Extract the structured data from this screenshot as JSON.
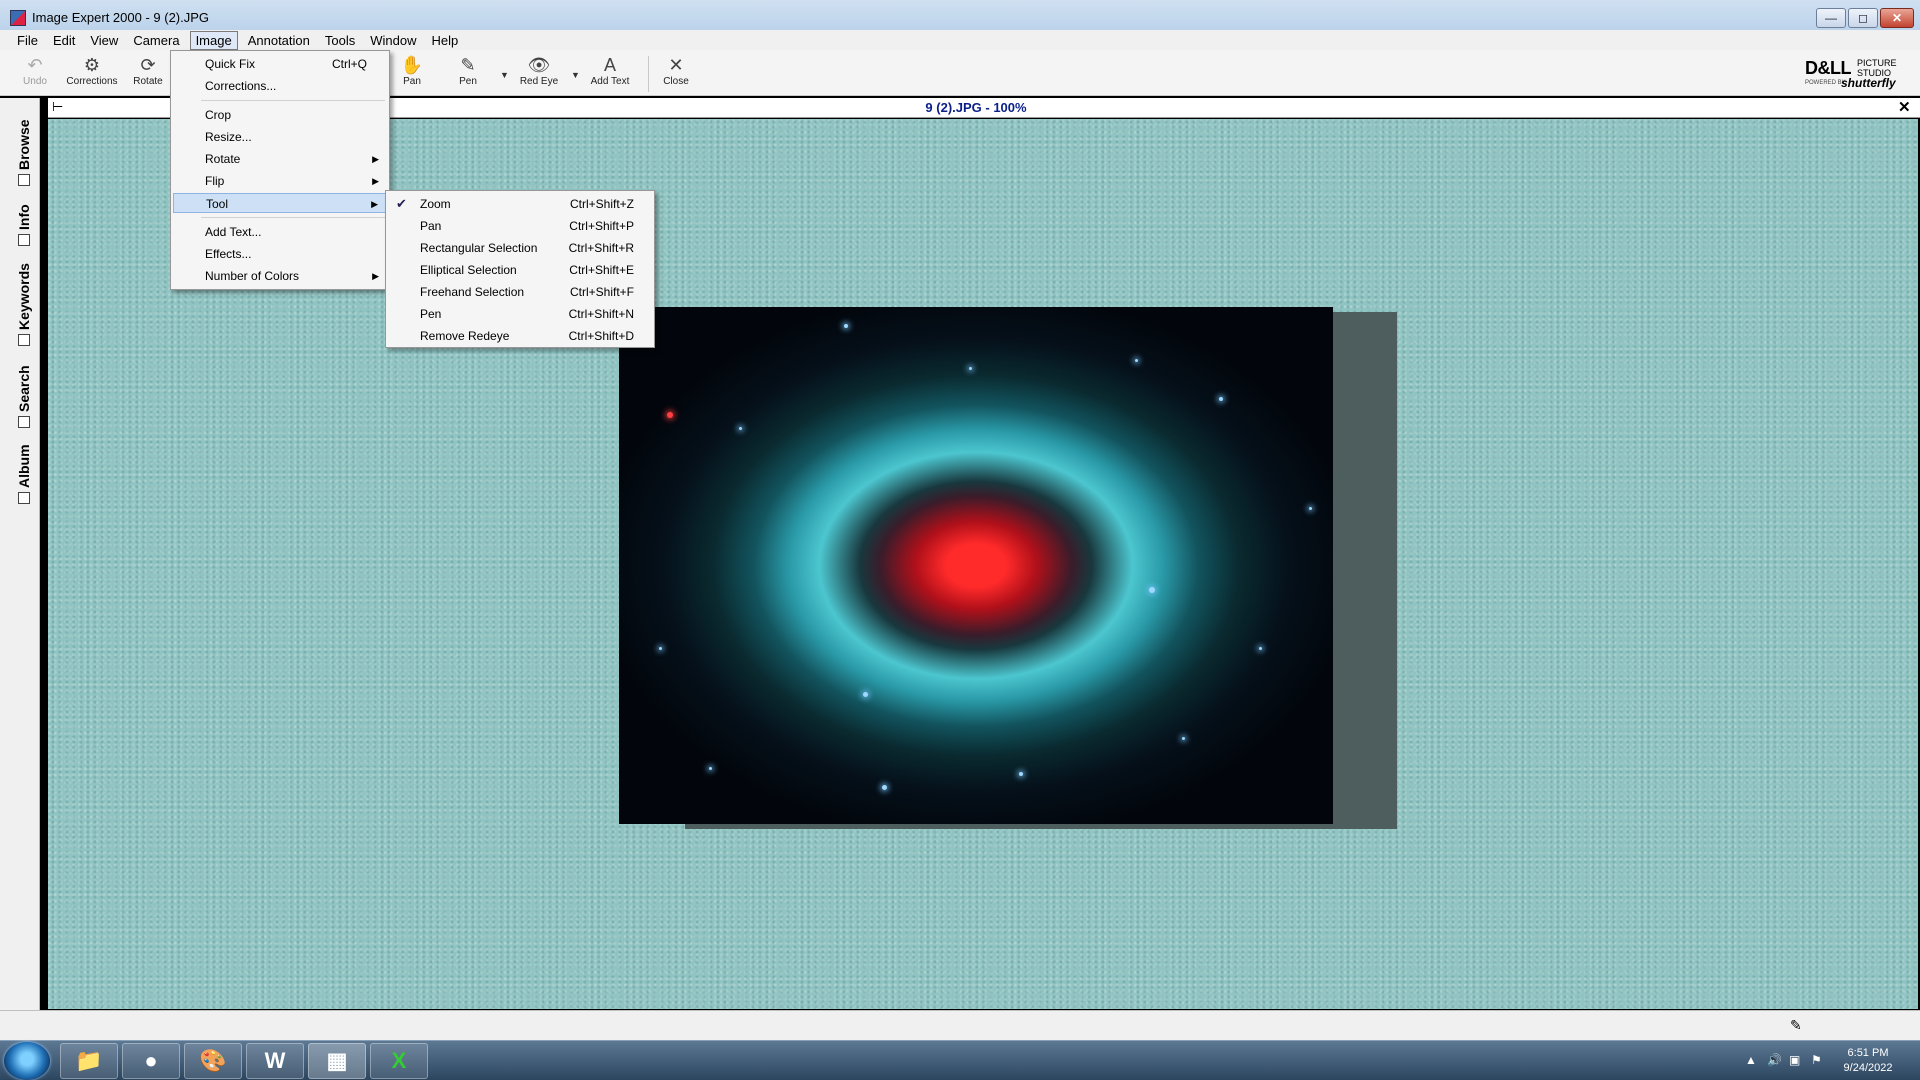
{
  "window": {
    "title": "Image Expert 2000 - 9 (2).JPG"
  },
  "menubar": [
    {
      "label": "File"
    },
    {
      "label": "Edit"
    },
    {
      "label": "View"
    },
    {
      "label": "Camera"
    },
    {
      "label": "Image"
    },
    {
      "label": "Annotation"
    },
    {
      "label": "Tools"
    },
    {
      "label": "Window"
    },
    {
      "label": "Help"
    }
  ],
  "toolbar": {
    "undo": "Undo",
    "corrections": "Corrections",
    "rotate": "Rotate",
    "pan": "Pan",
    "pen": "Pen",
    "red_eye": "Red Eye",
    "add_text": "Add Text",
    "close": "Close"
  },
  "brand": {
    "dell": "D&LL",
    "picture_studio": "PICTURE STUDIO",
    "powered_by": "POWERED BY",
    "shutterfly": "shutterfly"
  },
  "side_tabs": [
    {
      "label": "Browse"
    },
    {
      "label": "Info"
    },
    {
      "label": "Keywords"
    },
    {
      "label": "Search"
    },
    {
      "label": "Album"
    }
  ],
  "document": {
    "title": "9 (2).JPG - 100%"
  },
  "image_menu": {
    "items": [
      {
        "label": "Quick Fix",
        "shortcut": "Ctrl+Q"
      },
      {
        "label": "Corrections..."
      },
      {
        "label": "Crop"
      },
      {
        "label": "Resize..."
      },
      {
        "label": "Rotate"
      },
      {
        "label": "Flip"
      },
      {
        "label": "Tool"
      },
      {
        "label": "Add Text..."
      },
      {
        "label": "Effects..."
      },
      {
        "label": "Number of Colors"
      }
    ]
  },
  "tool_menu": {
    "items": [
      {
        "label": "Zoom",
        "shortcut": "Ctrl+Shift+Z",
        "checked": true
      },
      {
        "label": "Pan",
        "shortcut": "Ctrl+Shift+P"
      },
      {
        "label": "Rectangular Selection",
        "shortcut": "Ctrl+Shift+R"
      },
      {
        "label": "Elliptical Selection",
        "shortcut": "Ctrl+Shift+E"
      },
      {
        "label": "Freehand Selection",
        "shortcut": "Ctrl+Shift+F"
      },
      {
        "label": "Pen",
        "shortcut": "Ctrl+Shift+N"
      },
      {
        "label": "Remove Redeye",
        "shortcut": "Ctrl+Shift+D"
      }
    ]
  },
  "taskbar": {
    "apps": [
      {
        "icon": "folder-icon"
      },
      {
        "icon": "firefox-icon"
      },
      {
        "icon": "paint-icon"
      },
      {
        "icon": "word-icon",
        "text": "W"
      },
      {
        "icon": "image-expert-icon"
      },
      {
        "icon": "excel-icon",
        "text": "X"
      }
    ],
    "clock_time": "6:51 PM",
    "clock_date": "9/24/2022"
  }
}
